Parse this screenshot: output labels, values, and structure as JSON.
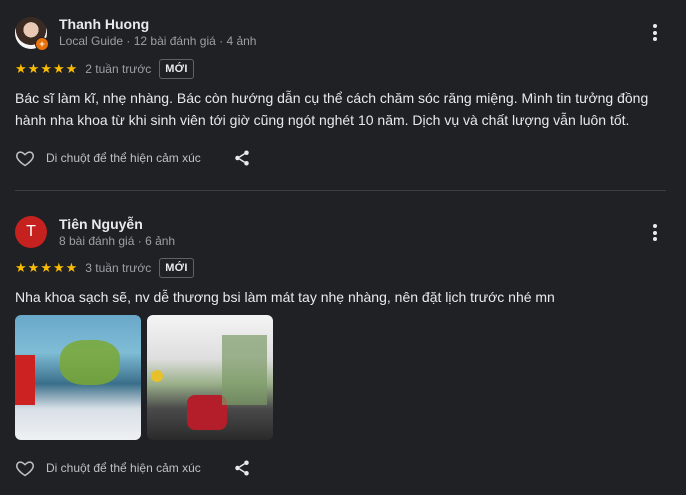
{
  "reviews": [
    {
      "name": "Thanh Huong",
      "meta": "Local Guide · 12 bài đánh giá · 4 ảnh",
      "avatar_type": "photo",
      "avatar_badge": "+",
      "stars": 5,
      "time": "2 tuần trước",
      "tag": "MỚI",
      "text": "Bác sĩ làm kĩ, nhẹ nhàng. Bác còn hướng dẫn cụ thể cách chăm sóc răng miệng. Mình tin tưởng đồng hành nha khoa từ khi sinh viên tới giờ cũng ngót nghét 10 năm. Dịch vụ và chất lượng vẫn luôn tốt.",
      "reaction_hint": "Di chuột để thể hiện cảm xúc"
    },
    {
      "name": "Tiên Nguyễn",
      "meta": "8 bài đánh giá · 6 ảnh",
      "avatar_type": "letter",
      "avatar_letter": "T",
      "avatar_color": "#c5221f",
      "stars": 5,
      "time": "3 tuần trước",
      "tag": "MỚI",
      "text": "Nha khoa sạch sẽ, nv dễ thương bsi làm mát tay nhẹ nhàng, nên đặt lịch trước nhé mn",
      "photos": [
        "clinic-interior-photo",
        "clinic-entrance-photo"
      ],
      "reaction_hint": "Di chuột để thể hiện cảm xúc"
    }
  ],
  "colors": {
    "star": "#fbbc04",
    "background": "#202124",
    "badge": "#e8710a"
  }
}
